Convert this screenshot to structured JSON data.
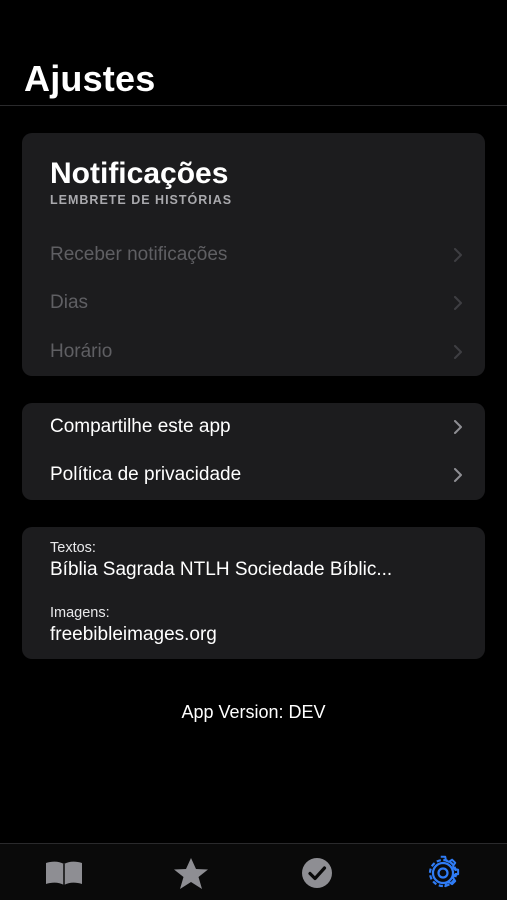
{
  "header": {
    "title": "Ajustes"
  },
  "notifications": {
    "title": "Notificações",
    "subtitle": "LEMBRETE DE HISTÓRIAS",
    "items": [
      {
        "label": "Receber notificações",
        "enabled": false
      },
      {
        "label": "Dias",
        "enabled": false
      },
      {
        "label": "Horário",
        "enabled": false
      }
    ]
  },
  "links": {
    "items": [
      {
        "label": "Compartilhe este app"
      },
      {
        "label": "Política de privacidade"
      }
    ]
  },
  "credits": {
    "texts_label": "Textos:",
    "texts_value": "Bíblia Sagrada NTLH Sociedade Bíblic...",
    "images_label": "Imagens:",
    "images_value": "freebibleimages.org"
  },
  "version": "App Version: DEV",
  "tabbar": {
    "tabs": [
      {
        "icon": "book-icon",
        "active": false
      },
      {
        "icon": "star-icon",
        "active": false
      },
      {
        "icon": "checkmark-circle-icon",
        "active": false
      },
      {
        "icon": "gear-icon",
        "active": true
      }
    ],
    "active_color": "#2f7cf6",
    "inactive_color": "#8e8e93"
  }
}
